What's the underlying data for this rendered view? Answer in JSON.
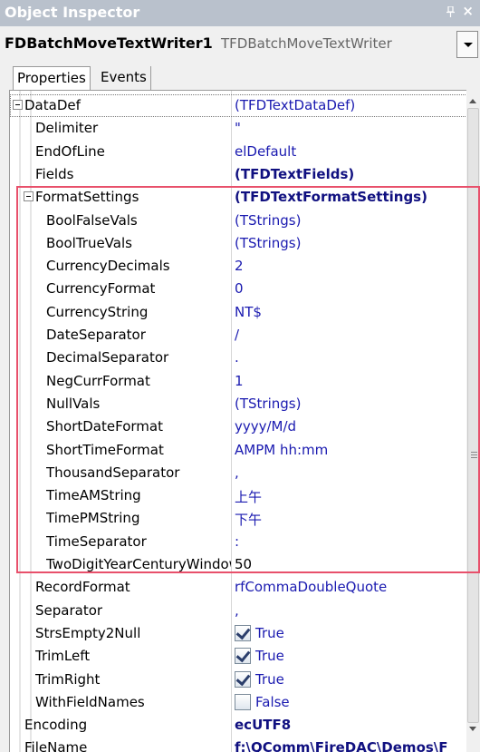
{
  "window": {
    "title": "Object Inspector",
    "accent_highlight": "#e8506b"
  },
  "object_selector": {
    "name": "FDBatchMoveTextWriter1",
    "class_name": "TFDBatchMoveTextWriter"
  },
  "tabs": [
    {
      "label": "Properties",
      "active": true
    },
    {
      "label": "Events",
      "active": false
    }
  ],
  "properties": [
    {
      "name": "DataDef",
      "value": "(TFDTextDataDef)",
      "level": 0,
      "expanded": true
    },
    {
      "name": "Delimiter",
      "value": "\"",
      "level": 1
    },
    {
      "name": "EndOfLine",
      "value": "elDefault",
      "level": 1
    },
    {
      "name": "Fields",
      "value": "(TFDTextFields)",
      "level": 1,
      "bold": true
    },
    {
      "name": "FormatSettings",
      "value": "(TFDTextFormatSettings)",
      "level": 1,
      "bold": true,
      "expanded": true
    },
    {
      "name": "BoolFalseVals",
      "value": "(TStrings)",
      "level": 2
    },
    {
      "name": "BoolTrueVals",
      "value": "(TStrings)",
      "level": 2
    },
    {
      "name": "CurrencyDecimals",
      "value": "2",
      "level": 2
    },
    {
      "name": "CurrencyFormat",
      "value": "0",
      "level": 2
    },
    {
      "name": "CurrencyString",
      "value": "NT$",
      "level": 2
    },
    {
      "name": "DateSeparator",
      "value": "/",
      "level": 2
    },
    {
      "name": "DecimalSeparator",
      "value": ".",
      "level": 2
    },
    {
      "name": "NegCurrFormat",
      "value": "1",
      "level": 2
    },
    {
      "name": "NullVals",
      "value": "(TStrings)",
      "level": 2
    },
    {
      "name": "ShortDateFormat",
      "value": "yyyy/M/d",
      "level": 2
    },
    {
      "name": "ShortTimeFormat",
      "value": "AMPM hh:mm",
      "level": 2
    },
    {
      "name": "ThousandSeparator",
      "value": ",",
      "level": 2
    },
    {
      "name": "TimeAMString",
      "value": "上午",
      "level": 2
    },
    {
      "name": "TimePMString",
      "value": "下午",
      "level": 2
    },
    {
      "name": "TimeSeparator",
      "value": ":",
      "level": 2
    },
    {
      "name": "TwoDigitYearCenturyWindow",
      "value": "50",
      "level": 2,
      "dark": true
    },
    {
      "name": "RecordFormat",
      "value": "rfCommaDoubleQuote",
      "level": 1
    },
    {
      "name": "Separator",
      "value": ",",
      "level": 1
    },
    {
      "name": "StrsEmpty2Null",
      "value": "True",
      "level": 1,
      "checkbox": true,
      "checked": true
    },
    {
      "name": "TrimLeft",
      "value": "True",
      "level": 1,
      "checkbox": true,
      "checked": true
    },
    {
      "name": "TrimRight",
      "value": "True",
      "level": 1,
      "checkbox": true,
      "checked": true
    },
    {
      "name": "WithFieldNames",
      "value": "False",
      "level": 1,
      "checkbox": true,
      "checked": false
    },
    {
      "name": "Encoding",
      "value": "ecUTF8",
      "level": 0,
      "bold": true
    },
    {
      "name": "FileName",
      "value": "f:\\QComm\\FireDAC\\Demos\\F",
      "level": 0,
      "bold": true
    }
  ]
}
